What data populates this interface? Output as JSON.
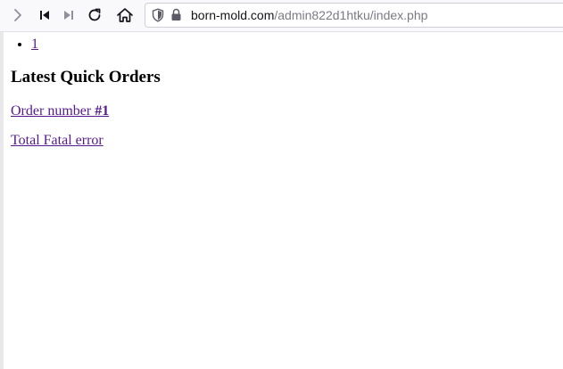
{
  "browser": {
    "url_host": "born-mold.com",
    "url_path": "/admin822d1htku/index.php",
    "icons": [
      "chevron-right-icon",
      "skip-back-icon",
      "skip-forward-icon",
      "reload-icon",
      "home-icon",
      "shield-icon",
      "lock-icon"
    ]
  },
  "page": {
    "pager_items": [
      "1"
    ],
    "section_title": "Latest Quick Orders",
    "order_link_prefix": "Order number ",
    "order_link_number": "#1",
    "total_link": "Total Fatal error"
  },
  "colors": {
    "visited_link": "#551a8b",
    "toolbar_bg": "#f9f9fb"
  }
}
